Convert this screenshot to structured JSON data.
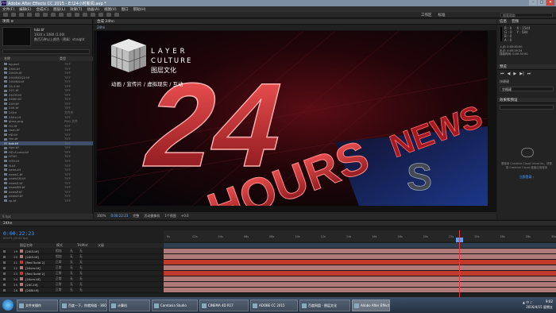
{
  "window": {
    "title": "Adobe After Effects CC 2015 - E:\\24小时新闻.aep *",
    "app_badge": "Ae"
  },
  "menu": [
    "文件(F)",
    "编辑(E)",
    "合成(C)",
    "图层(L)",
    "效果(T)",
    "动画(A)",
    "视图(V)",
    "窗口",
    "帮助(H)"
  ],
  "toolbar": {
    "workspaces": [
      "工作区",
      "标准"
    ],
    "search_placeholder": "搜索帮助"
  },
  "project": {
    "tab": "项目 ≡",
    "selected_name": "hdz.tif",
    "selected_info": [
      "1920 x 1080 (1.00)",
      "",
      "数百万种以上颜色（预乘）straight"
    ],
    "col_name": "名称",
    "col_type": "类型",
    "items": [
      [
        "bg.psd",
        "TIFF"
      ],
      [
        "24t4.tif",
        "TIFF"
      ],
      [
        "24t4H.tif",
        "TIFF"
      ],
      [
        "24t4Nt2Q2.tif",
        "TIFF"
      ],
      [
        "24t4N4.tif",
        "TIFF"
      ],
      [
        "24-4.tif",
        "TIFF"
      ],
      [
        "24C.tif",
        "TIFF"
      ],
      [
        "24CM.tif",
        "TIFF"
      ],
      [
        "24Mtl.tif",
        "TIFF"
      ],
      [
        "24H.tif",
        "TIFF"
      ],
      [
        "24tl.tif",
        "TIFF"
      ],
      [
        "24tm",
        "文件夹"
      ],
      [
        "24tm.tif",
        "TIFF"
      ],
      [
        "glass.png",
        "PNG 文件"
      ],
      [
        "H1.tif",
        "TIFF"
      ],
      [
        "Hsm.tif",
        "TIFF"
      ],
      [
        "HD.tif",
        "TIFF"
      ],
      [
        "Hm.tif",
        "TIFF"
      ],
      [
        "hdz.tif",
        "TIFF"
      ],
      [
        "Hpe.tif",
        "TIFF"
      ],
      [
        "HD-A.color.tif",
        "TIFF"
      ],
      [
        "HT.tif",
        "TIFF"
      ],
      [
        "HTH.tif",
        "TIFF"
      ],
      [
        "N.tif",
        "TIFF"
      ],
      [
        "news.tif",
        "TIFF"
      ],
      [
        "newsC.tif",
        "TIFF"
      ],
      [
        "newsCM.tif",
        "TIFF"
      ],
      [
        "newsS.tif",
        "TIFF"
      ],
      [
        "newsSM.tif",
        "TIFF"
      ],
      [
        "newsP.tif",
        "TIFF"
      ],
      [
        "newsH.tif",
        "TIFF"
      ],
      [
        "sp.tif",
        "TIFF"
      ]
    ],
    "footer": "8 bpc"
  },
  "viewer": {
    "tab_label": "合成 24hn",
    "sub_tab": "24hn",
    "logo_top": "LAYER",
    "logo_mid": "CULTURE",
    "logo_cn": "图层文化",
    "tagline": "动画 / 宣传片 / 虚拟现实 / 互动",
    "headline_num": "24",
    "headline_text": "HOURS",
    "headline_news": "NEWS",
    "zoom": "100%",
    "timecode": "0:00:22:23",
    "quality": "完整",
    "camera": "活动摄像机",
    "views": "1个视图",
    "offset": "+0.0"
  },
  "right_panel": {
    "tabs": [
      "信息",
      "音频"
    ],
    "info_lines": [
      "R : 0",
      "G : 0",
      "B : 0",
      "A : 0"
    ],
    "coords": [
      "X : 1544",
      "Y : 584"
    ],
    "timing": [
      "入点: 0:00:00:00",
      "出点: 0:00:29:24",
      "持续时间: 0:00:30:00"
    ],
    "preview_tab": "预览",
    "preview_label": "快捷键",
    "preview_key": "空格键",
    "effects_tab": "效果和预设",
    "library_text": "要使用 Creative Cloud Libraries，请登录 Creative Cloud 桌面应用程序",
    "library_link": "立即登录 ›"
  },
  "timeline": {
    "tab": "24hn",
    "timecode": "0:00:22:23",
    "fps": "00573 (25.00 fps)",
    "col_source": "图层名称",
    "col_mode": "模式",
    "col_trkmat": "TrkMat",
    "col_parent": "父级",
    "ruler": [
      "0s",
      "02s",
      "04s",
      "06s",
      "08s",
      "10s",
      "12s",
      "14s",
      "16s",
      "18s",
      "20s",
      "22s",
      "24s",
      "26s",
      "28s",
      "30s"
    ],
    "layers": [
      {
        "num": "19",
        "name": "[24t3.tif]",
        "mode": "相加",
        "color": "#b07a7a"
      },
      {
        "num": "20",
        "name": "[24t3.tif]",
        "mode": "相加",
        "color": "#b07a7a"
      },
      {
        "num": "21",
        "name": "[Red Solid 2]",
        "mode": "正常",
        "color": "#c0392b"
      },
      {
        "num": "22",
        "name": "[24cm.tif]",
        "mode": "正常",
        "color": "#b07a7a"
      },
      {
        "num": "23",
        "name": "[Red Solid 2]",
        "mode": "正常",
        "color": "#c0392b"
      },
      {
        "num": "24",
        "name": "[24cm.tif]",
        "mode": "正常",
        "color": "#b07a7a"
      },
      {
        "num": "25",
        "name": "[24C.tif]",
        "mode": "正常",
        "color": "#b07a7a"
      },
      {
        "num": "26",
        "name": "[24Bl.tif]",
        "mode": "正常",
        "color": "#b07a7a"
      }
    ],
    "track_values": [
      "无",
      "无",
      "无",
      "无",
      "无",
      "无",
      "无",
      "无"
    ]
  },
  "taskbar": {
    "items": [
      "文件夹操作",
      "百度一下，你就知道 - 360",
      "计算机",
      "Camtasia Studio",
      "CINEMA 4D R17",
      "ADOBE CC 2015",
      "百度网盘 - 图层文化",
      "Adobe After Effects"
    ],
    "active_index": 7,
    "clock_time": "9:02",
    "clock_date": "2016/4/15 星期五"
  }
}
